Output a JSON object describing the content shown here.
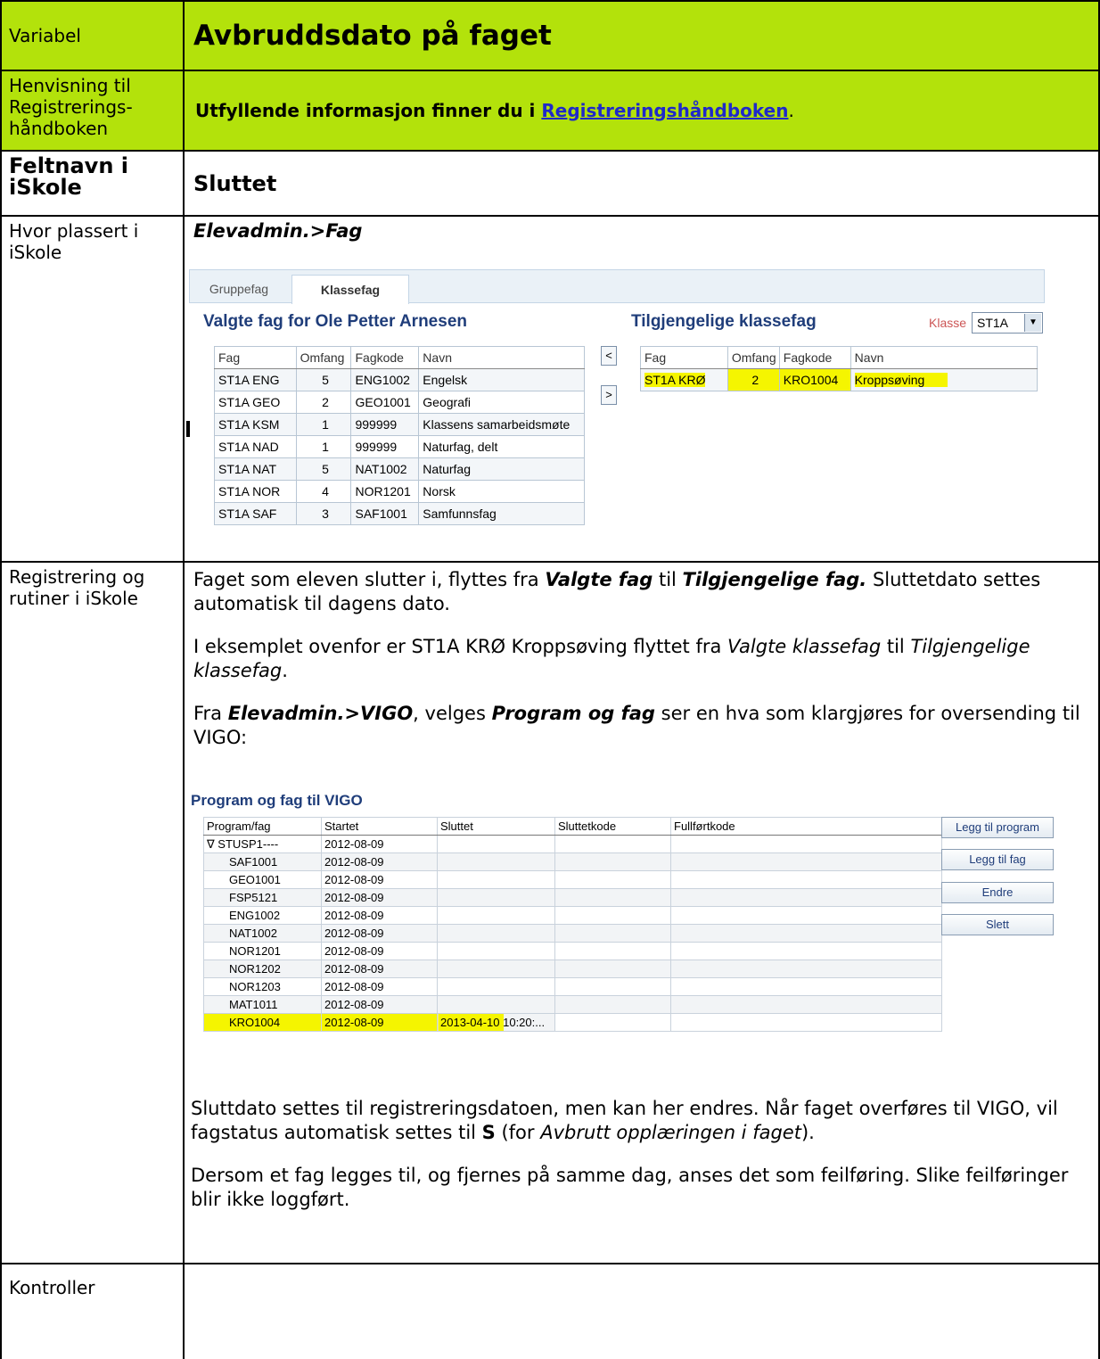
{
  "row_variabel": {
    "label": "Variabel",
    "title": "Avbruddsdato på faget"
  },
  "row_henvisning": {
    "label": "Henvisning til Registrerings-håndboken",
    "text_prefix": "Utfyllende informasjon finner du i ",
    "link": "Registreringshåndboken",
    "text_suffix": "."
  },
  "row_feltnavn": {
    "label": "Feltnavn i iSkole",
    "value": "Sluttet"
  },
  "row_hvor": {
    "label": "Hvor plassert i iSkole",
    "path": "Elevadmin.>Fag"
  },
  "screenshot1": {
    "tabs": [
      "Gruppefag",
      "Klassefag"
    ],
    "left_title": "Valgte fag for Ole Petter Arnesen",
    "right_title": "Tilgjengelige klassefag",
    "klasse_label": "Klasse",
    "klasse_value": "ST1A",
    "columns": [
      "Fag",
      "Omfang",
      "Fagkode",
      "Navn"
    ],
    "left_rows": [
      [
        "ST1A ENG",
        "5",
        "ENG1002",
        "Engelsk"
      ],
      [
        "ST1A GEO",
        "2",
        "GEO1001",
        "Geografi"
      ],
      [
        "ST1A KSM",
        "1",
        "999999",
        "Klassens samarbeidsmøte"
      ],
      [
        "ST1A NAD",
        "1",
        "999999",
        "Naturfag, delt"
      ],
      [
        "ST1A NAT",
        "5",
        "NAT1002",
        "Naturfag"
      ],
      [
        "ST1A NOR",
        "4",
        "NOR1201",
        "Norsk"
      ],
      [
        "ST1A SAF",
        "3",
        "SAF1001",
        "Samfunnsfag"
      ]
    ],
    "right_rows": [
      [
        "ST1A KRØ",
        "2",
        "KRO1004",
        "Kroppsøving"
      ]
    ],
    "btn_left": "<",
    "btn_right": ">"
  },
  "row_registrering": {
    "label": "Registrering og rutiner i iSkole",
    "p1": {
      "a": "Faget som eleven slutter i, flyttes fra ",
      "b": "Valgte fag",
      "c": " til ",
      "d": "Tilgjengelige fag.",
      "e": " Sluttetdato settes automatisk til dagens dato."
    },
    "p2": {
      "a": "I eksemplet ovenfor er ST1A KRØ Kroppsøving flyttet fra ",
      "b": "Valgte klassefag",
      "c": " til ",
      "d": "Tilgjengelige klassefag",
      "e": "."
    },
    "p3": {
      "a": "Fra ",
      "b": "Elevadmin.>VIGO",
      "c": ", velges ",
      "d": "Program og fag",
      "e": " ser en hva som klargjøres for oversending til VIGO:"
    },
    "p4": {
      "a": "Sluttdato settes til registreringsdatoen, men kan her endres. Når faget overføres til VIGO, vil fagstatus automatisk settes til ",
      "b": "S",
      "c": " (for ",
      "d": "Avbrutt opplæringen i faget",
      "e": ")."
    },
    "p5": "Dersom et fag legges til, og fjernes på samme dag, anses det som feilføring. Slike feilføringer blir ikke loggført."
  },
  "screenshot2": {
    "title": "Program og fag til VIGO",
    "columns": [
      "Program/fag",
      "Startet",
      "Sluttet",
      "Sluttetkode",
      "Fullførtkode"
    ],
    "rows": [
      [
        "∇ STUSP1----",
        "2012-08-09",
        "",
        "",
        ""
      ],
      [
        "SAF1001",
        "2012-08-09",
        "",
        "",
        ""
      ],
      [
        "GEO1001",
        "2012-08-09",
        "",
        "",
        ""
      ],
      [
        "FSP5121",
        "2012-08-09",
        "",
        "",
        ""
      ],
      [
        "ENG1002",
        "2012-08-09",
        "",
        "",
        ""
      ],
      [
        "NAT1002",
        "2012-08-09",
        "",
        "",
        ""
      ],
      [
        "NOR1201",
        "2012-08-09",
        "",
        "",
        ""
      ],
      [
        "NOR1202",
        "2012-08-09",
        "",
        "",
        ""
      ],
      [
        "NOR1203",
        "2012-08-09",
        "",
        "",
        ""
      ],
      [
        "MAT1011",
        "2012-08-09",
        "",
        "",
        ""
      ],
      [
        "KRO1004",
        "2012-08-09",
        "2013-04-10 10:20:...",
        "",
        ""
      ]
    ],
    "buttons": [
      "Legg til program",
      "Legg til fag",
      "Endre",
      "Slett"
    ]
  },
  "row_kontroller": {
    "label": "Kontroller"
  },
  "colors": {
    "header_green": "#b3e20b",
    "link_blue": "#1f29c9",
    "highlight": "#f5f500"
  }
}
